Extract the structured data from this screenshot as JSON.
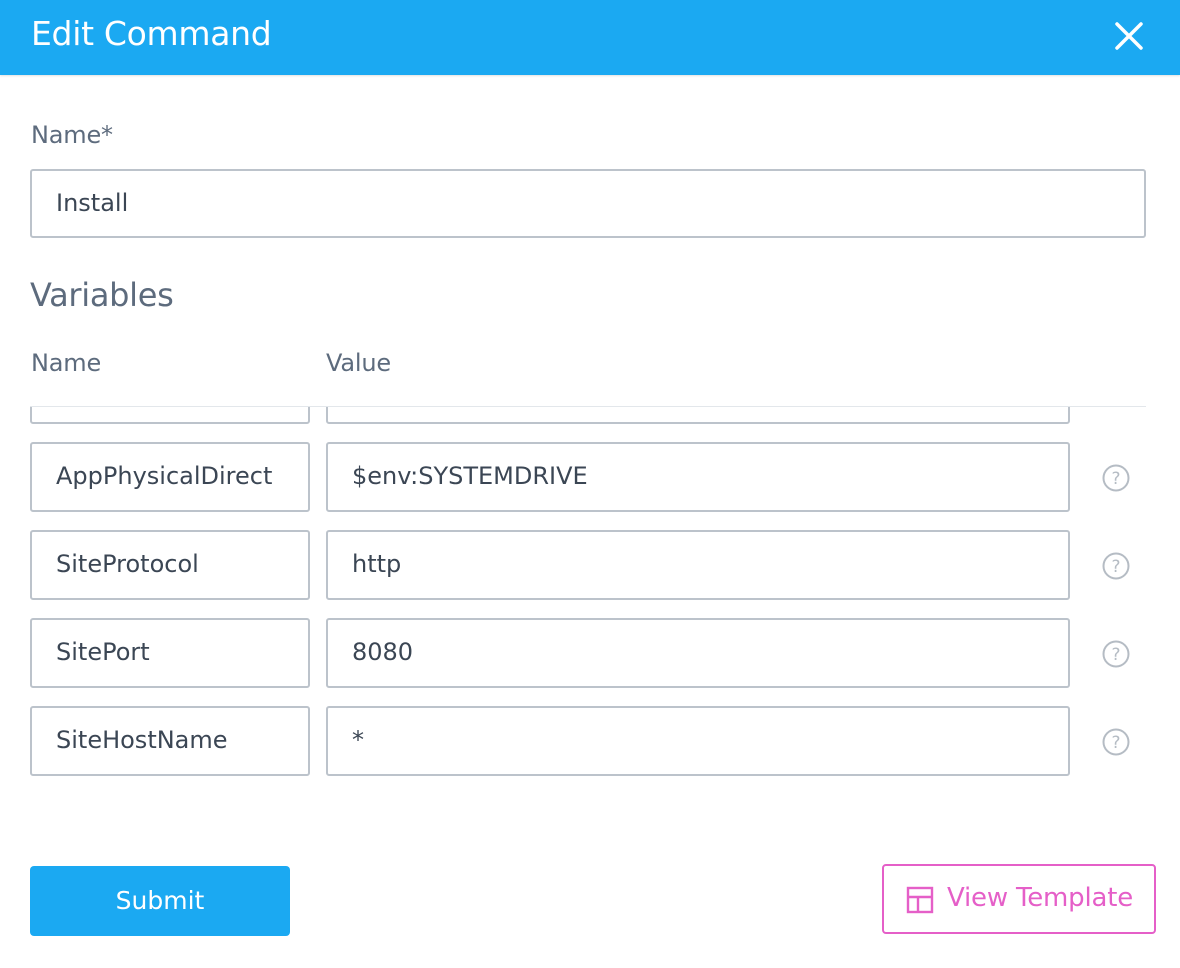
{
  "dialog": {
    "title": "Edit Command",
    "close_icon": "close-icon"
  },
  "form": {
    "name_label": "Name*",
    "name_value": "Install",
    "variables_title": "Variables",
    "col_name": "Name",
    "col_value": "Value"
  },
  "variables": [
    {
      "name": "",
      "value": ""
    },
    {
      "name": "AppPhysicalDirect",
      "value": "$env:SYSTEMDRIVE"
    },
    {
      "name": "SiteProtocol",
      "value": "http"
    },
    {
      "name": "SitePort",
      "value": "8080"
    },
    {
      "name": "SiteHostName",
      "value": "*"
    }
  ],
  "actions": {
    "submit_label": "Submit",
    "view_template_label": "View Template",
    "view_template_icon": "template-icon"
  },
  "colors": {
    "header": "#1ba9f2",
    "primary_button": "#1ba9f2",
    "template_accent": "#e55fc8",
    "label_text": "#5d6b7d",
    "input_border": "#bcc3cb"
  }
}
